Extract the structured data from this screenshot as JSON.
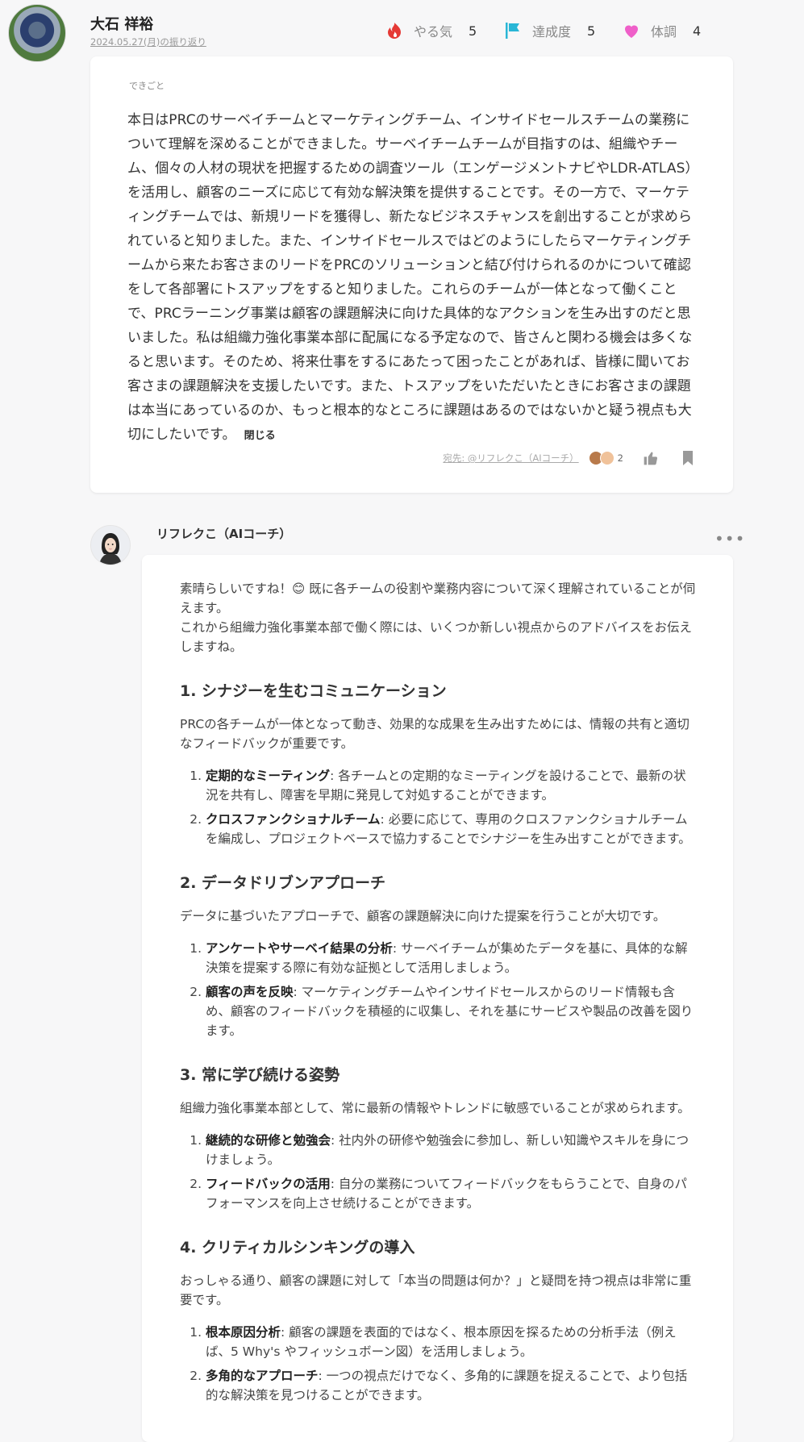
{
  "header": {
    "author_name": "大石 祥裕",
    "date_link": "2024.05.27(月)の振り返り",
    "stats": [
      {
        "icon": "flame-icon",
        "label": "やる気",
        "value": "5",
        "color": "#e53935"
      },
      {
        "icon": "flag-icon",
        "label": "達成度",
        "value": "5",
        "color": "#29b6d6"
      },
      {
        "icon": "heart-icon",
        "label": "体調",
        "value": "4",
        "color": "#ef5fc9"
      }
    ]
  },
  "journal": {
    "section_label": "できごと",
    "text": "本日はPRCのサーベイチームとマーケティングチーム、インサイドセールスチームの業務について理解を深めることができました。サーベイチームチームが目指すのは、組織やチーム、個々の人材の現状を把握するための調査ツール（エンゲージメントナビやLDR-ATLAS）を活用し、顧客のニーズに応じて有効な解決策を提供することです。その一方で、マーケティングチームでは、新規リードを獲得し、新たなビジネスチャンスを創出することが求められていると知りました。また、インサイドセールスではどのようにしたらマーケティングチームから来たお客さまのリードをPRCのソリューションと結び付けられるのかについて確認をして各部署にトスアップをすると知りました。これらのチームが一体となって働くことで、PRCラーニング事業は顧客の課題解決に向けた具体的なアクションを生み出すのだと思いました。私は組織力強化事業本部に配属になる予定なので、皆さんと関わる機会は多くなると思います。そのため、将来仕事をするにあたって困ったことがあれば、皆様に聞いてお客さまの課題解決を支援したいです。また、トスアップをいただいたときにお客さまの課題は本当にあっているのか、もっと根本的なところに課題はあるのではないかと疑う視点も大切にしたいです。",
    "close_label": "閉じる",
    "to_label": "宛先: @リフレクこ（AIコーチ）",
    "reaction_count": "2"
  },
  "coach": {
    "name": "リフレクこ（AIコーチ）",
    "more_label": "•••",
    "intro1": "素晴らしいですね！😊 既に各チームの役割や業務内容について深く理解されていることが伺えます。",
    "intro2": "これから組織力強化事業本部で働く際には、いくつか新しい視点からのアドバイスをお伝えしますね。",
    "sections": [
      {
        "heading": "1. シナジーを生むコミュニケーション",
        "text": "PRCの各チームが一体となって動き、効果的な成果を生み出すためには、情報の共有と適切なフィードバックが重要です。",
        "items": [
          {
            "bold": "定期的なミーティング",
            "text": ": 各チームとの定期的なミーティングを設けることで、最新の状況を共有し、障害を早期に発見して対処することができます。"
          },
          {
            "bold": "クロスファンクショナルチーム",
            "text": ": 必要に応じて、専用のクロスファンクショナルチームを編成し、プロジェクトベースで協力することでシナジーを生み出すことができます。"
          }
        ]
      },
      {
        "heading": "2. データドリブンアプローチ",
        "text": "データに基づいたアプローチで、顧客の課題解決に向けた提案を行うことが大切です。",
        "items": [
          {
            "bold": "アンケートやサーベイ結果の分析",
            "text": ": サーベイチームが集めたデータを基に、具体的な解決策を提案する際に有効な証拠として活用しましょう。"
          },
          {
            "bold": "顧客の声を反映",
            "text": ": マーケティングチームやインサイドセールスからのリード情報も含め、顧客のフィードバックを積極的に収集し、それを基にサービスや製品の改善を図ります。"
          }
        ]
      },
      {
        "heading": "3. 常に学び続ける姿勢",
        "text": "組織力強化事業本部として、常に最新の情報やトレンドに敏感でいることが求められます。",
        "items": [
          {
            "bold": "継続的な研修と勉強会",
            "text": ": 社内外の研修や勉強会に参加し、新しい知識やスキルを身につけましょう。"
          },
          {
            "bold": "フィードバックの活用",
            "text": ": 自分の業務についてフィードバックをもらうことで、自身のパフォーマンスを向上させ続けることができます。"
          }
        ]
      },
      {
        "heading": "4. クリティカルシンキングの導入",
        "text": "おっしゃる通り、顧客の課題に対して「本当の問題は何か？」と疑問を持つ視点は非常に重要です。",
        "items": [
          {
            "bold": "根本原因分析",
            "text": ": 顧客の課題を表面的ではなく、根本原因を探るための分析手法（例えば、5 Why's やフィッシュボーン図）を活用しましょう。"
          },
          {
            "bold": "多角的なアプローチ",
            "text": ": 一つの視点だけでなく、多角的に課題を捉えることで、より包括的な解決策を見つけることができます。"
          }
        ]
      }
    ]
  }
}
